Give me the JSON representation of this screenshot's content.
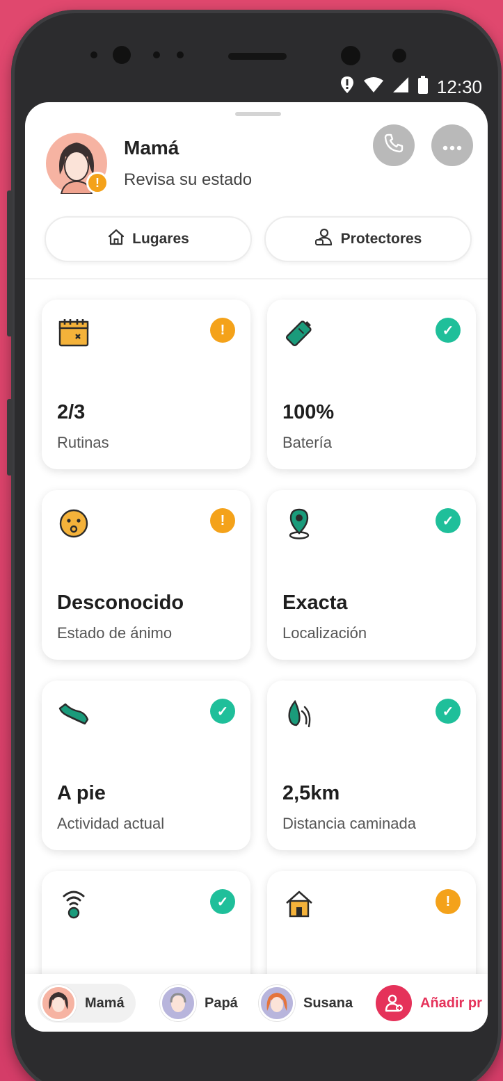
{
  "status_bar": {
    "time": "12:30"
  },
  "profile": {
    "name": "Mamá",
    "status": "Revisa su estado",
    "avatar_icon": "mom-avatar-icon",
    "warning_badge": "!"
  },
  "header_actions": {
    "call_icon": "phone-icon",
    "more_icon": "more-dots-icon"
  },
  "pills": [
    {
      "label": "Lugares",
      "icon": "home-outline-icon"
    },
    {
      "label": "Protectores",
      "icon": "protectors-icon"
    }
  ],
  "cards": [
    {
      "value": "2/3",
      "label": "Rutinas",
      "icon": "calendar-icon",
      "status": "warning"
    },
    {
      "value": "100%",
      "label": "Batería",
      "icon": "battery-icon",
      "status": "ok"
    },
    {
      "value": "Desconocido",
      "label": "Estado de ánimo",
      "icon": "mood-face-icon",
      "status": "warning"
    },
    {
      "value": "Exacta",
      "label": "Localización",
      "icon": "location-pin-icon",
      "status": "ok"
    },
    {
      "value": "A pie",
      "label": "Actividad actual",
      "icon": "shoe-icon",
      "status": "ok"
    },
    {
      "value": "2,5km",
      "label": "Distancia caminada",
      "icon": "footsteps-icon",
      "status": "ok"
    },
    {
      "value": "",
      "label": "",
      "icon": "wifi-signal-icon",
      "status": "ok"
    },
    {
      "value": "",
      "label": "",
      "icon": "house-icon",
      "status": "warning"
    }
  ],
  "members": [
    {
      "name": "Mamá",
      "active": true
    },
    {
      "name": "Papá",
      "active": false
    },
    {
      "name": "Susana",
      "active": false
    }
  ],
  "add_member": {
    "label": "Añadir pr",
    "icon": "add-person-icon"
  },
  "colors": {
    "background": "#e0486e",
    "ok": "#1fbf9a",
    "warning": "#f4a21a",
    "accent": "#e5325a",
    "icon_green": "#1a9b7b",
    "icon_yellow": "#f4b23a"
  }
}
